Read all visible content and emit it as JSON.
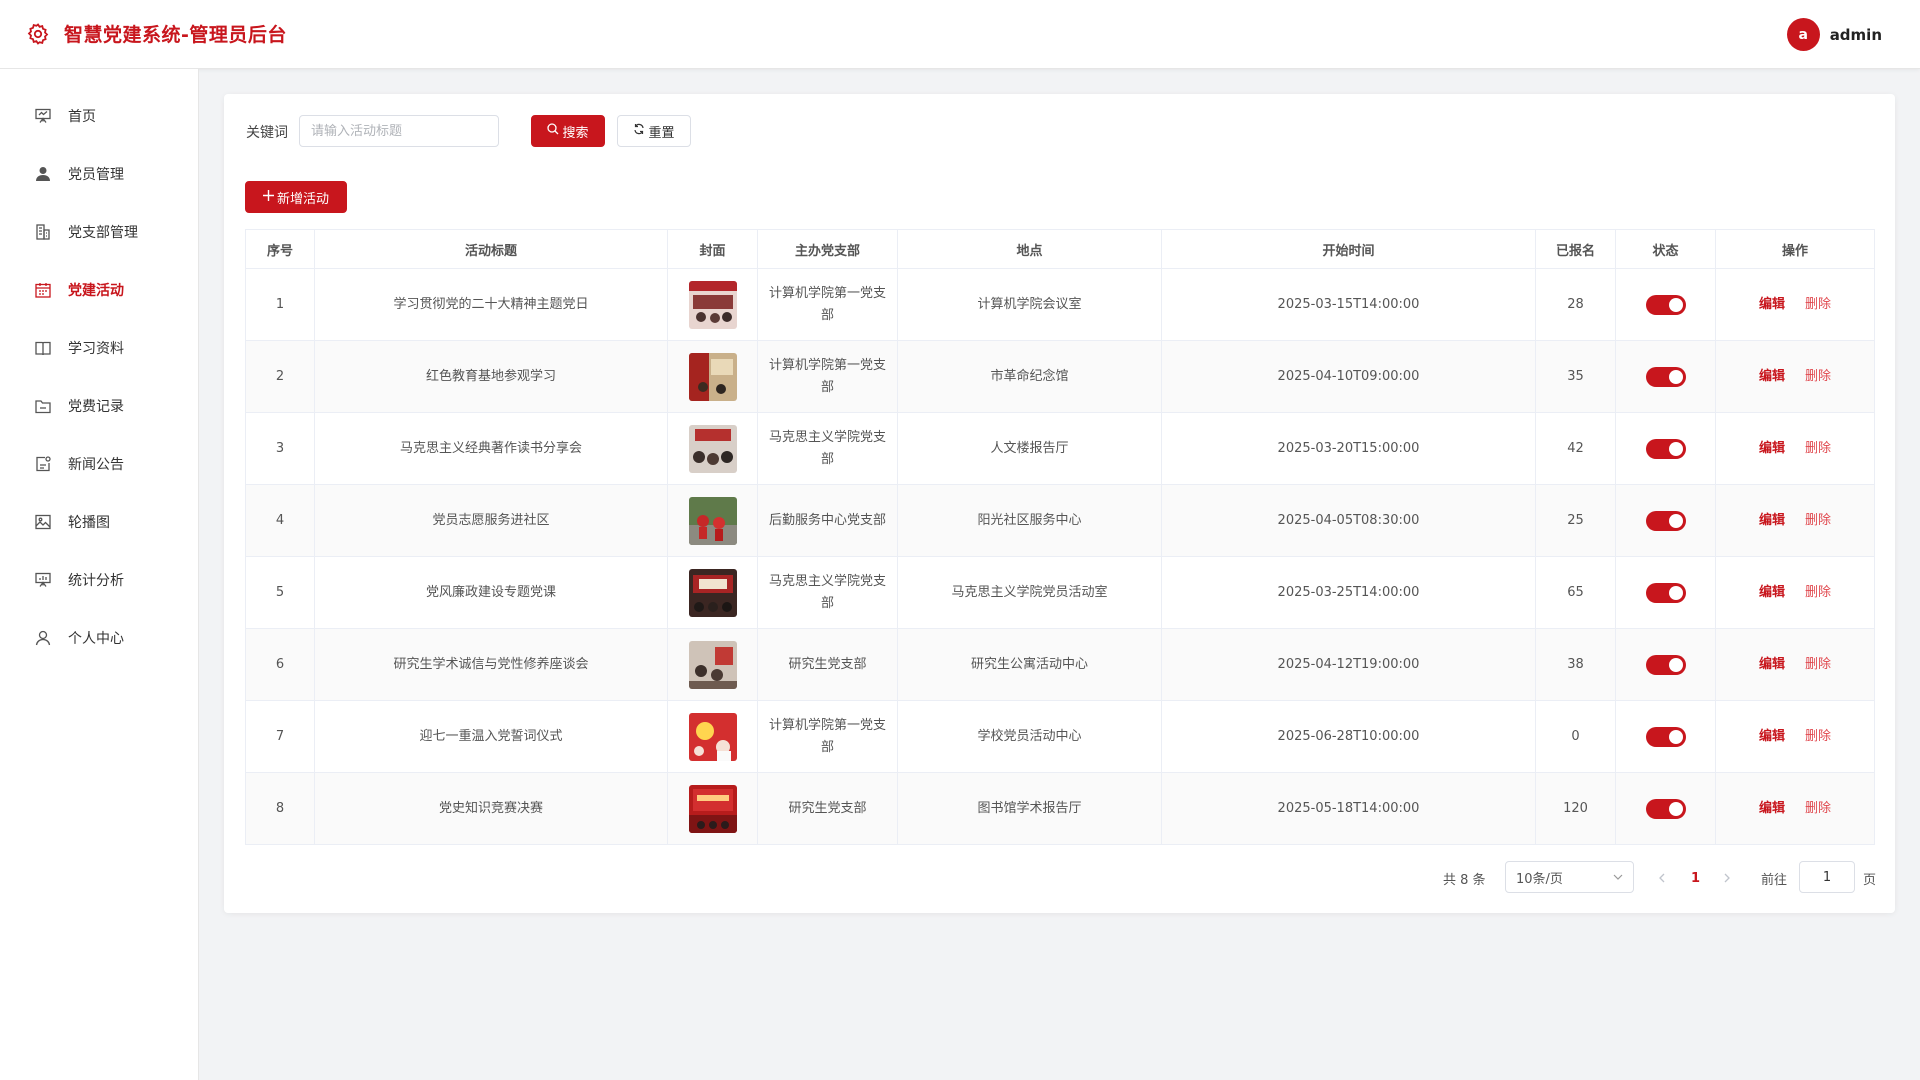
{
  "header": {
    "title": "智慧党建系统-管理员后台",
    "avatar_letter": "a",
    "username": "admin",
    "brand_color": "#c8161d"
  },
  "sidebar": {
    "items": [
      {
        "label": "首页",
        "icon": "presentation-icon",
        "active": false
      },
      {
        "label": "党员管理",
        "icon": "user-icon",
        "active": false
      },
      {
        "label": "党支部管理",
        "icon": "building-icon",
        "active": false
      },
      {
        "label": "党建活动",
        "icon": "calendar-icon",
        "active": true
      },
      {
        "label": "学习资料",
        "icon": "book-icon",
        "active": false
      },
      {
        "label": "党费记录",
        "icon": "folder-icon",
        "active": false
      },
      {
        "label": "新闻公告",
        "icon": "news-icon",
        "active": false
      },
      {
        "label": "轮播图",
        "icon": "image-icon",
        "active": false
      },
      {
        "label": "统计分析",
        "icon": "chart-icon",
        "active": false
      },
      {
        "label": "个人中心",
        "icon": "person-icon",
        "active": false
      }
    ]
  },
  "search": {
    "label": "关键词",
    "placeholder": "请输入活动标题",
    "value": "",
    "search_button": "搜索",
    "reset_button": "重置"
  },
  "toolbar": {
    "add_button": "新增活动"
  },
  "table": {
    "columns": [
      "序号",
      "活动标题",
      "封面",
      "主办党支部",
      "地点",
      "开始时间",
      "已报名",
      "状态",
      "操作"
    ],
    "rows": [
      {
        "index": "1",
        "title": "学习贯彻党的二十大精神主题党日",
        "branch": "计算机学院第一党支部",
        "location": "计算机学院会议室",
        "start": "2025-03-15T14:00:00",
        "signed": "28",
        "status": true
      },
      {
        "index": "2",
        "title": "红色教育基地参观学习",
        "branch": "计算机学院第一党支部",
        "location": "市革命纪念馆",
        "start": "2025-04-10T09:00:00",
        "signed": "35",
        "status": true
      },
      {
        "index": "3",
        "title": "马克思主义经典著作读书分享会",
        "branch": "马克思主义学院党支部",
        "location": "人文楼报告厅",
        "start": "2025-03-20T15:00:00",
        "signed": "42",
        "status": true
      },
      {
        "index": "4",
        "title": "党员志愿服务进社区",
        "branch": "后勤服务中心党支部",
        "location": "阳光社区服务中心",
        "start": "2025-04-05T08:30:00",
        "signed": "25",
        "status": true
      },
      {
        "index": "5",
        "title": "党风廉政建设专题党课",
        "branch": "马克思主义学院党支部",
        "location": "马克思主义学院党员活动室",
        "start": "2025-03-25T14:00:00",
        "signed": "65",
        "status": true
      },
      {
        "index": "6",
        "title": "研究生学术诚信与党性修养座谈会",
        "branch": "研究生党支部",
        "location": "研究生公寓活动中心",
        "start": "2025-04-12T19:00:00",
        "signed": "38",
        "status": true
      },
      {
        "index": "7",
        "title": "迎七一重温入党誓词仪式",
        "branch": "计算机学院第一党支部",
        "location": "学校党员活动中心",
        "start": "2025-06-28T10:00:00",
        "signed": "0",
        "status": true
      },
      {
        "index": "8",
        "title": "党史知识竞赛决赛",
        "branch": "研究生党支部",
        "location": "图书馆学术报告厅",
        "start": "2025-05-18T14:00:00",
        "signed": "120",
        "status": true
      }
    ],
    "edit_label": "编辑",
    "delete_label": "删除"
  },
  "pagination": {
    "total_text": "共 8 条",
    "page_size": "10条/页",
    "current_page": "1",
    "goto_label": "前往",
    "goto_value": "1",
    "page_suffix": "页"
  }
}
